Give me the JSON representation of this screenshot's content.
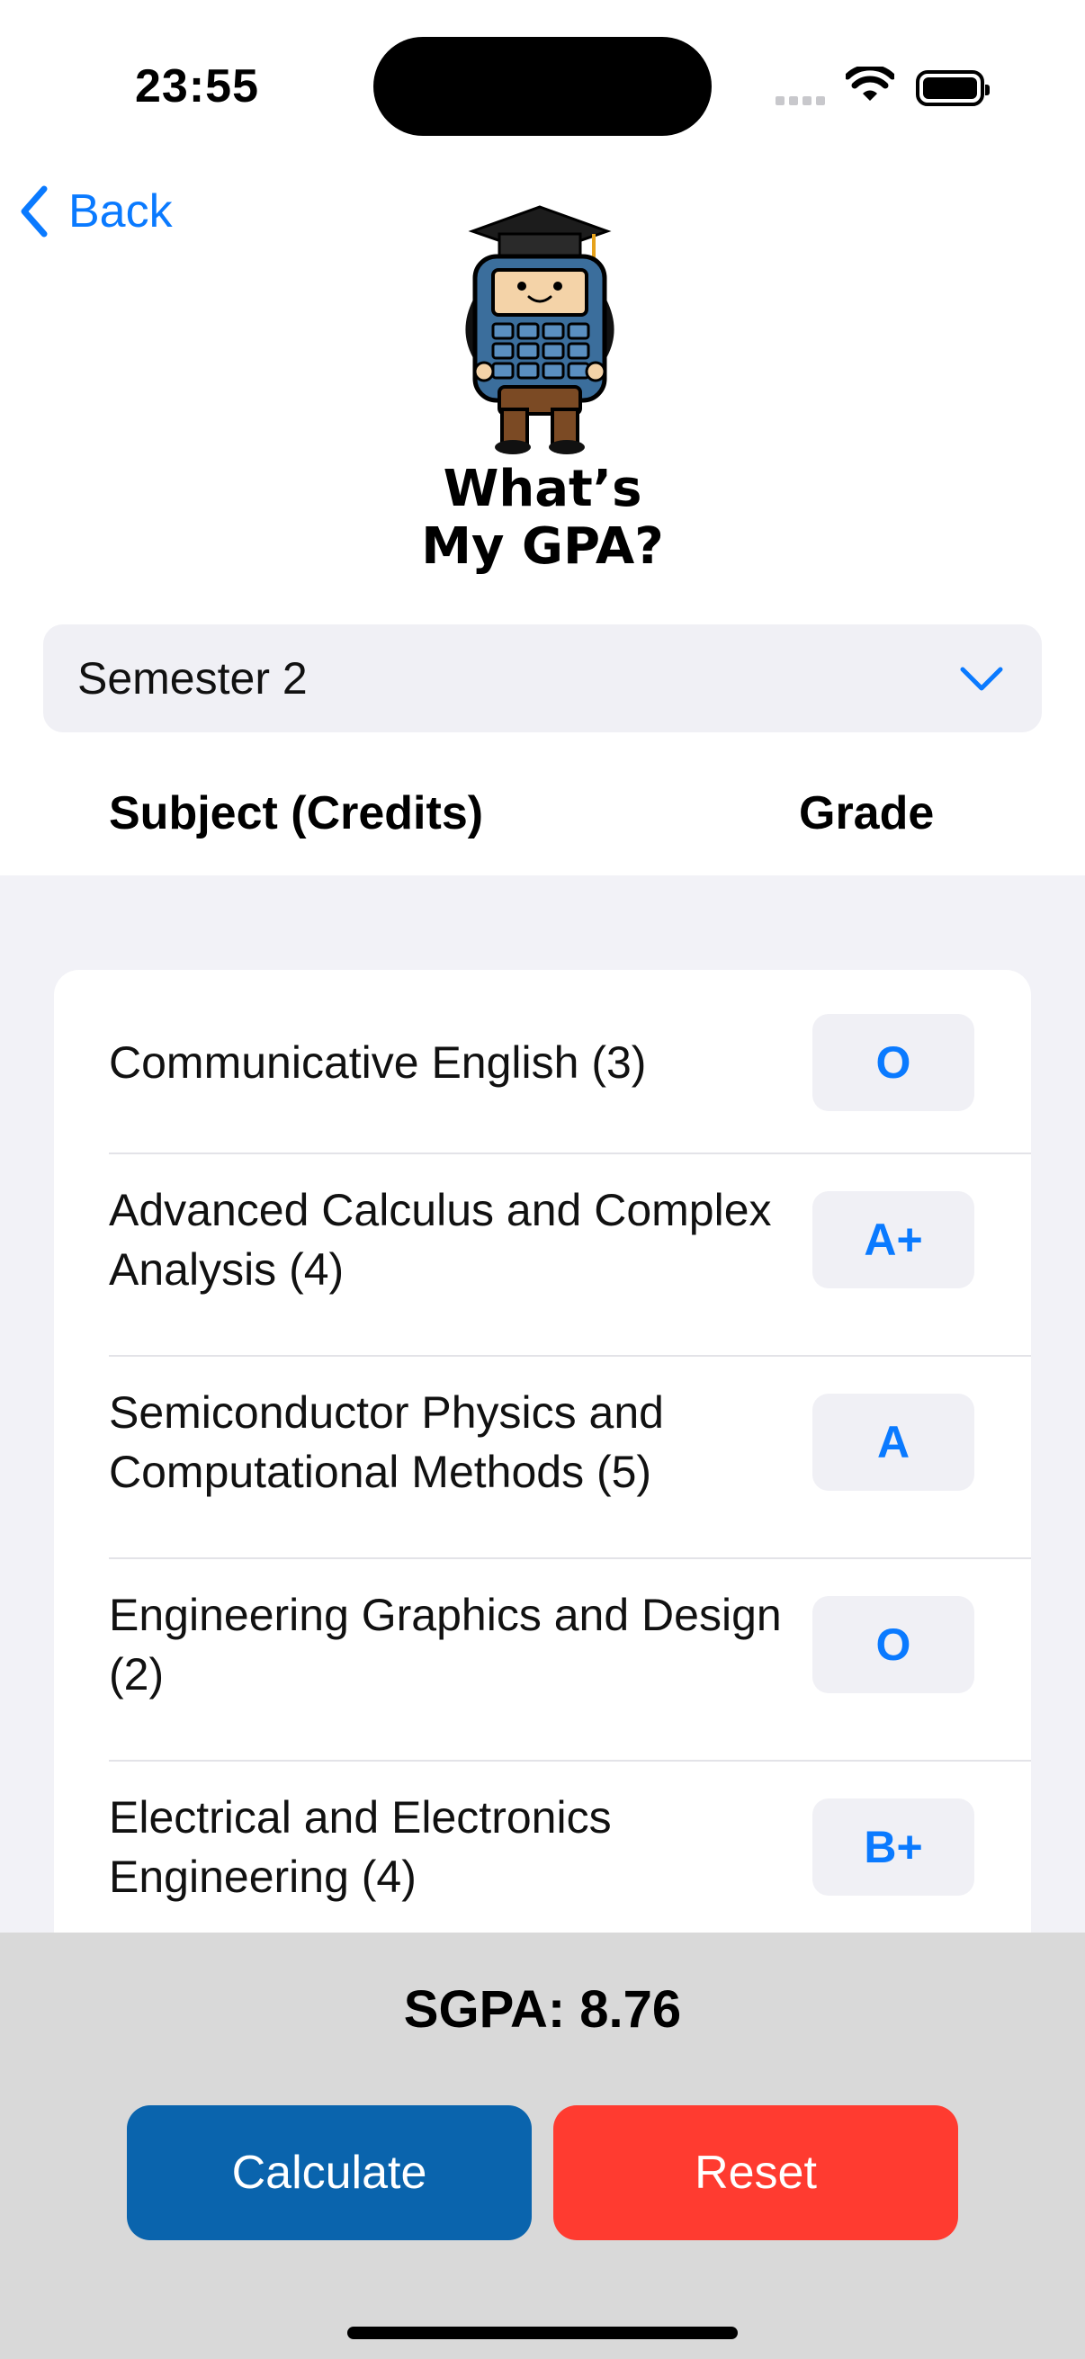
{
  "status_bar": {
    "time": "23:55"
  },
  "nav": {
    "back_label": "Back"
  },
  "app": {
    "title_line1": "What’s",
    "title_line2": "My GPA?"
  },
  "semester_select": {
    "selected": "Semester 2"
  },
  "table_header": {
    "subject": "Subject (Credits)",
    "grade": "Grade"
  },
  "subjects": [
    {
      "name": "Communicative English (3)",
      "grade": "O"
    },
    {
      "name": "Advanced Calculus and Complex Analysis (4)",
      "grade": "A+"
    },
    {
      "name": "Semiconductor Physics and Computational Methods (5)",
      "grade": "A"
    },
    {
      "name": "Engineering Graphics and Design (2)",
      "grade": "O"
    },
    {
      "name": "Electrical and Electronics Engineering (4)",
      "grade": "B+"
    }
  ],
  "result": {
    "sgpa_text": "SGPA: 8.76"
  },
  "actions": {
    "calculate_label": "Calculate",
    "reset_label": "Reset"
  },
  "colors": {
    "accent": "#0a7aff",
    "calculate": "#0a64ad",
    "reset": "#ff3b30"
  }
}
